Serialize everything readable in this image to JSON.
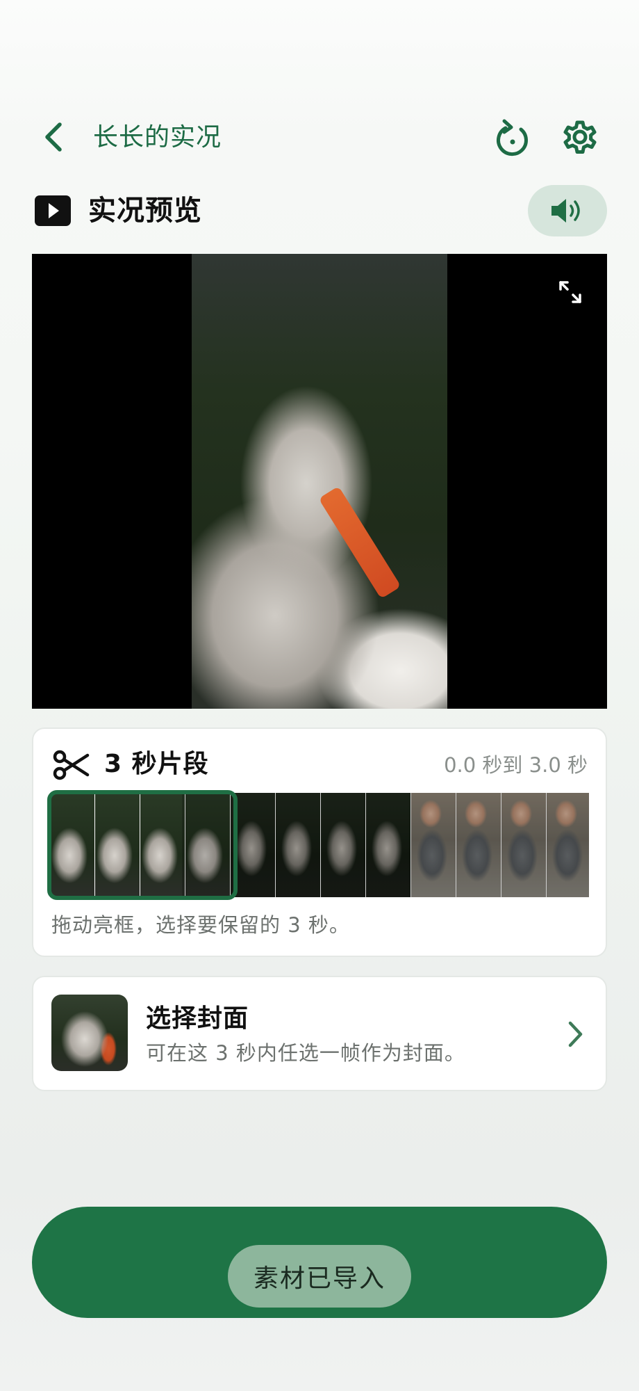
{
  "header": {
    "title": "长长的实况",
    "back_icon": "chevron-left-icon",
    "reset_icon": "rotate-ccw-icon",
    "settings_icon": "gear-icon"
  },
  "preview": {
    "icon": "play-icon",
    "title": "实况预览",
    "sound_icon": "speaker-on-icon",
    "expand_icon": "expand-icon"
  },
  "clip": {
    "icon": "scissors-icon",
    "title": "3 秒片段",
    "range": "0.0 秒到 3.0 秒",
    "hint": "拖动亮框，选择要保留的 3 秒。"
  },
  "cover": {
    "title": "选择封面",
    "subtitle": "可在这 3 秒内任选一帧作为封面。",
    "chevron_icon": "chevron-right-icon"
  },
  "import": {
    "label": "素材已导入"
  },
  "colors": {
    "accent": "#1e7446",
    "accent_soft": "#d6e5dc",
    "title_green": "#1d6b45"
  }
}
